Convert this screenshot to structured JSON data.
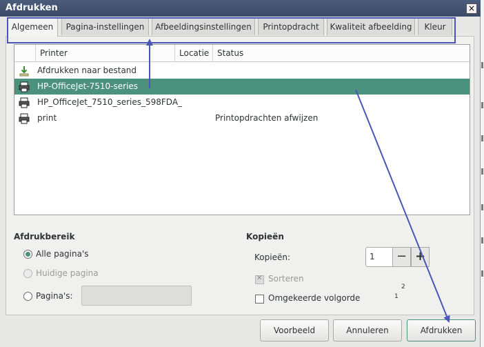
{
  "window": {
    "title": "Afdrukken",
    "close_glyph": "×"
  },
  "tabs": [
    {
      "label": "Algemeen",
      "active": true
    },
    {
      "label": "Pagina-instellingen"
    },
    {
      "label": "Afbeeldingsinstellingen"
    },
    {
      "label": "Printopdracht"
    },
    {
      "label": "Kwaliteit afbeelding"
    },
    {
      "label": "Kleur"
    }
  ],
  "printer_table": {
    "columns": [
      "Printer",
      "Locatie",
      "Status"
    ],
    "rows": [
      {
        "icon": "print-to-file-icon",
        "name": "Afdrukken naar bestand",
        "location": "",
        "status": ""
      },
      {
        "icon": "printer-icon",
        "name": "HP-OfficeJet-7510-series",
        "location": "",
        "status": "",
        "selected": true
      },
      {
        "icon": "printer-icon",
        "name": "HP_OfficeJet_7510_series_598FDA_",
        "location": "",
        "status": ""
      },
      {
        "icon": "printer-icon",
        "name": "print",
        "location": "",
        "status": "Printopdrachten afwijzen"
      }
    ]
  },
  "range": {
    "title": "Afdrukbereik",
    "all_pages": "Alle pagina's",
    "current_page": "Huidige pagina",
    "pages": "Pagina's:",
    "pages_value": ""
  },
  "copies": {
    "title": "Kopieën",
    "label": "Kopieën:",
    "value": "1",
    "minus": "−",
    "plus": "+",
    "collate": "Sorteren",
    "reverse": "Omgekeerde volgorde",
    "collate_preview_1": "1",
    "collate_preview_2": "2"
  },
  "buttons": {
    "preview": "Voorbeeld",
    "cancel": "Annuleren",
    "print": "Afdrukken"
  },
  "colors": {
    "accent": "#4b917e",
    "annotation": "#4a55b8",
    "titlebar": "#3f4e6c"
  }
}
